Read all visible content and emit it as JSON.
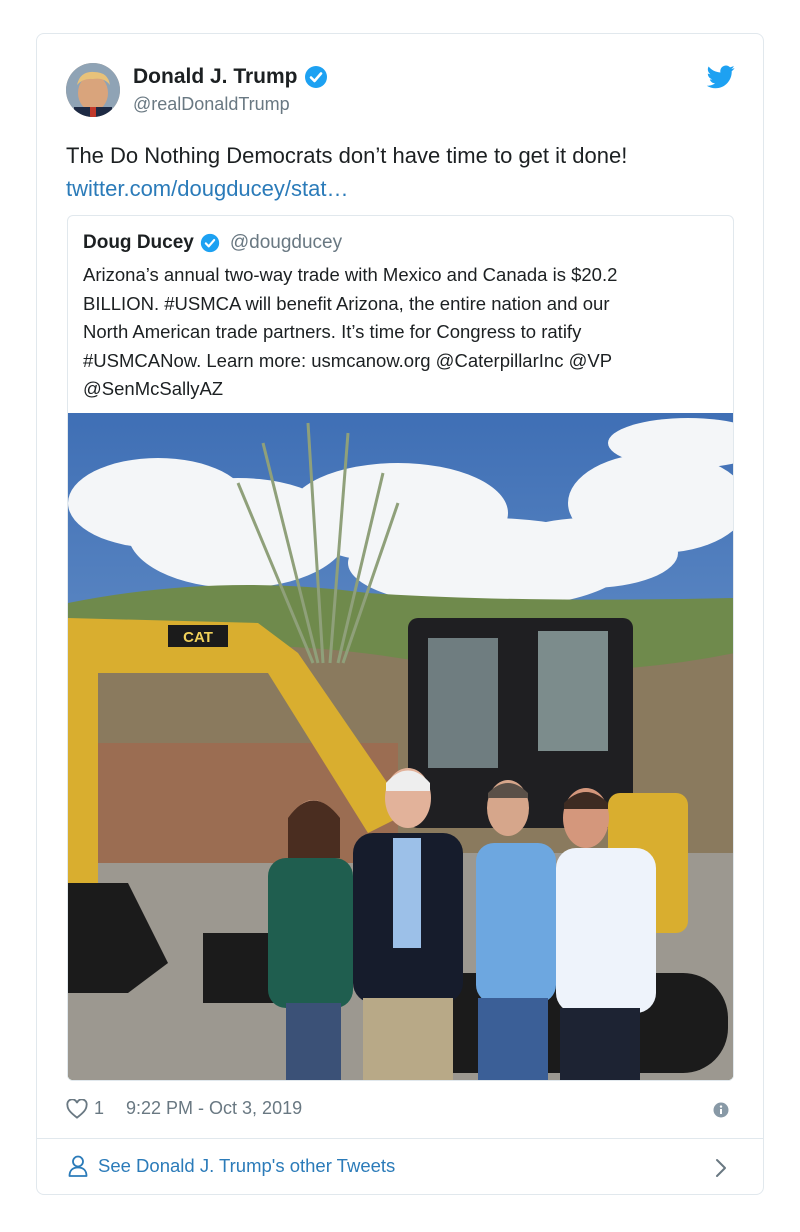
{
  "tweet": {
    "author_name": "Donald J. Trump",
    "author_handle": "@realDonaldTrump",
    "text": "The Do Nothing Democrats don’t have time to get it done!",
    "link": "twitter.com/dougducey/stat…",
    "likes": "1",
    "timestamp": "9:22 PM - Oct 3, 2019"
  },
  "quoted": {
    "author_name": "Doug Ducey",
    "author_handle": "@dougducey",
    "lines": [
      "Arizona’s annual two-way trade with Mexico and Canada is $20.2",
      "BILLION. #USMCA will benefit Arizona, the entire nation and our",
      "North American trade partners. It’s time for Congress to ratify",
      "#USMCANow. Learn more: usmcanow.org @CaterpillarInc @VP",
      "@SenMcSallyAZ"
    ],
    "photo_brand": "CAT"
  },
  "footer": {
    "other_tweets": "See Donald J. Trump's other Tweets"
  },
  "colors": {
    "link": "#2b7bb9",
    "verified": "#1da1f2",
    "muted": "#697882",
    "border": "#e1e8ed"
  },
  "icons": [
    "verified-badge-icon",
    "twitter-bird-icon",
    "heart-icon",
    "info-icon",
    "person-icon",
    "chevron-right-icon"
  ]
}
